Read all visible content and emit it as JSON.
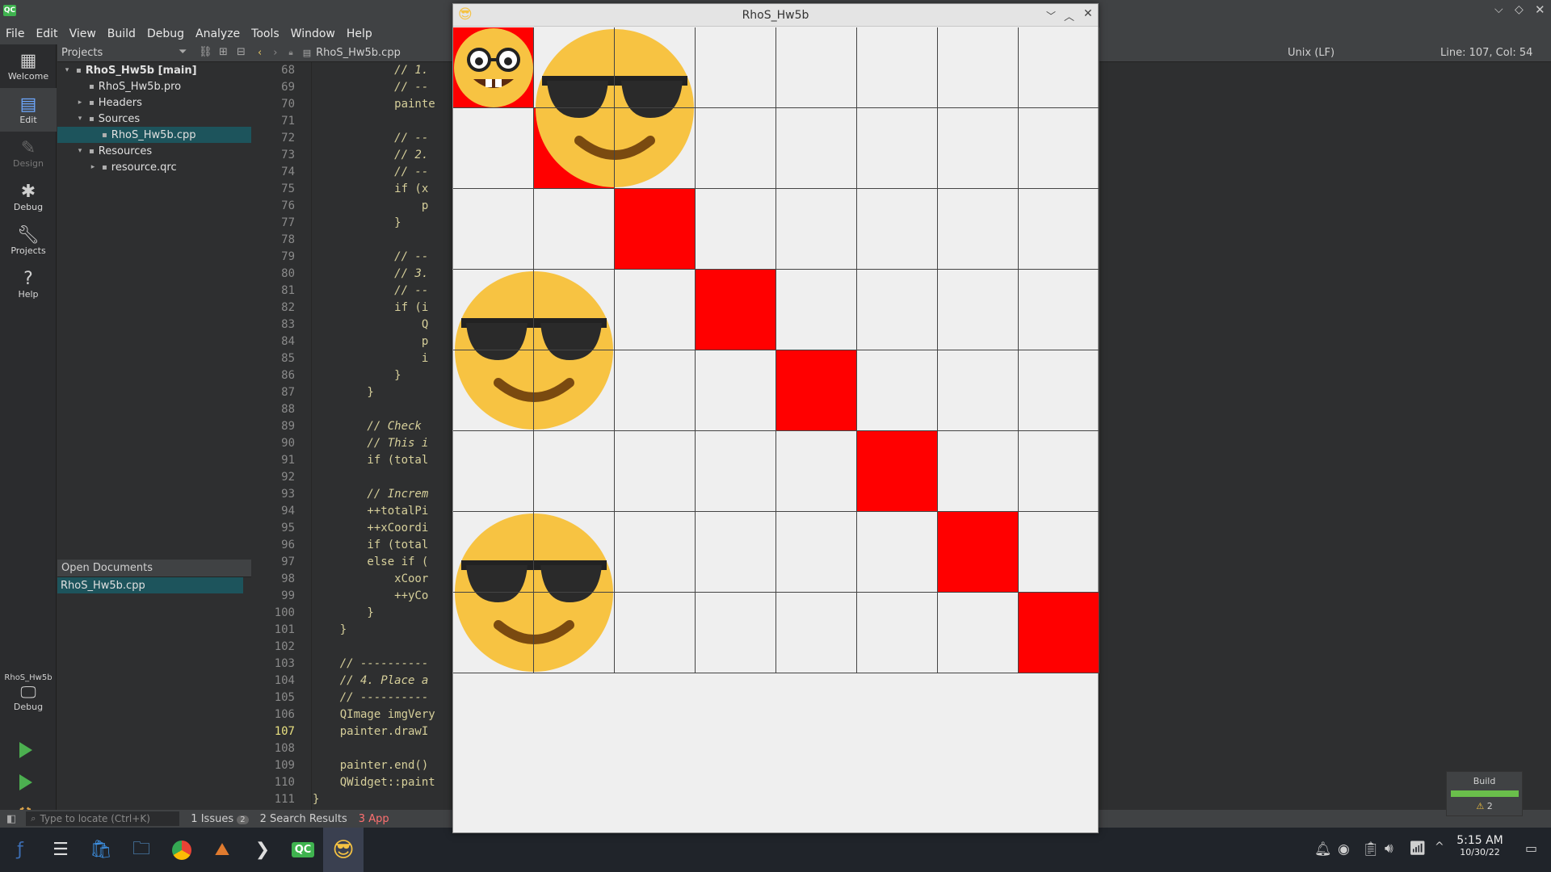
{
  "menu": [
    "File",
    "Edit",
    "View",
    "Build",
    "Debug",
    "Analyze",
    "Tools",
    "Window",
    "Help"
  ],
  "modes": [
    {
      "label": "Welcome",
      "icon": "grid-icon",
      "active": false
    },
    {
      "label": "Edit",
      "icon": "edit-icon",
      "active": true
    },
    {
      "label": "Design",
      "icon": "pen-icon",
      "active": false
    },
    {
      "label": "Debug",
      "icon": "bug-icon",
      "active": false
    },
    {
      "label": "Projects",
      "icon": "wrench-icon",
      "active": false
    },
    {
      "label": "Help",
      "icon": "help-icon",
      "active": false
    }
  ],
  "kit": {
    "project": "RhoS_Hw5b",
    "mode": "Debug"
  },
  "projects": {
    "title": "Projects",
    "tree": [
      {
        "label": "RhoS_Hw5b [main]",
        "indent": 0,
        "bold": true,
        "exp": "▾"
      },
      {
        "label": "RhoS_Hw5b.pro",
        "indent": 1,
        "exp": ""
      },
      {
        "label": "Headers",
        "indent": 1,
        "exp": "▸"
      },
      {
        "label": "Sources",
        "indent": 1,
        "exp": "▾"
      },
      {
        "label": "RhoS_Hw5b.cpp",
        "indent": 2,
        "exp": "",
        "sel": true
      },
      {
        "label": "Resources",
        "indent": 1,
        "exp": "▾"
      },
      {
        "label": "resource.qrc",
        "indent": 2,
        "exp": "▸"
      }
    ]
  },
  "open_documents": {
    "title": "Open Documents",
    "items": [
      "RhoS_Hw5b.cpp"
    ]
  },
  "editor": {
    "file": "RhoS_Hw5b.cpp",
    "encoding": "Unix (LF)",
    "cursor": "Line: 107, Col: 54",
    "current_line": 107,
    "lines": [
      {
        "n": "68",
        "t": "            // 1."
      },
      {
        "n": "69",
        "t": "            // --"
      },
      {
        "n": "70",
        "t": "            painte"
      },
      {
        "n": "71",
        "t": ""
      },
      {
        "n": "72",
        "t": "            // --"
      },
      {
        "n": "73",
        "t": "            // 2."
      },
      {
        "n": "74",
        "t": "            // --"
      },
      {
        "n": "75",
        "t": "            if (x"
      },
      {
        "n": "76",
        "t": "                p"
      },
      {
        "n": "77",
        "t": "            }"
      },
      {
        "n": "78",
        "t": ""
      },
      {
        "n": "79",
        "t": "            // --"
      },
      {
        "n": "80",
        "t": "            // 3."
      },
      {
        "n": "81",
        "t": "            // --"
      },
      {
        "n": "82",
        "t": "            if (i"
      },
      {
        "n": "83",
        "t": "                Q"
      },
      {
        "n": "84",
        "t": "                p"
      },
      {
        "n": "85",
        "t": "                i"
      },
      {
        "n": "86",
        "t": "            }"
      },
      {
        "n": "87",
        "t": "        }"
      },
      {
        "n": "88",
        "t": ""
      },
      {
        "n": "89",
        "t": "        // Check"
      },
      {
        "n": "90",
        "t": "        // This i"
      },
      {
        "n": "91",
        "t": "        if (total"
      },
      {
        "n": "92",
        "t": ""
      },
      {
        "n": "93",
        "t": "        // Increm"
      },
      {
        "n": "94",
        "t": "        ++totalPi"
      },
      {
        "n": "95",
        "t": "        ++xCoordi"
      },
      {
        "n": "96",
        "t": "        if (total"
      },
      {
        "n": "97",
        "t": "        else if ("
      },
      {
        "n": "98",
        "t": "            xCoor"
      },
      {
        "n": "99",
        "t": "            ++yCo"
      },
      {
        "n": "100",
        "t": "        }"
      },
      {
        "n": "101",
        "t": "    }"
      },
      {
        "n": "102",
        "t": ""
      },
      {
        "n": "103",
        "t": "    // ----------"
      },
      {
        "n": "104",
        "t": "    // 4. Place a"
      },
      {
        "n": "105",
        "t": "    // ----------"
      },
      {
        "n": "106",
        "t": "    QImage imgVery"
      },
      {
        "n": "107",
        "t": "    painter.drawI"
      },
      {
        "n": "108",
        "t": ""
      },
      {
        "n": "109",
        "t": "    painter.end()"
      },
      {
        "n": "110",
        "t": "    QWidget::paint"
      },
      {
        "n": "111",
        "t": "}"
      }
    ]
  },
  "output_tabs": [
    {
      "num": "1",
      "label": "Issues",
      "badge": "2"
    },
    {
      "num": "2",
      "label": "Search Results"
    },
    {
      "num": "3",
      "label": "App"
    }
  ],
  "locator": {
    "placeholder": "Type to locate (Ctrl+K)"
  },
  "build": {
    "label": "Build",
    "warnings": "2"
  },
  "app_window": {
    "title": "RhoS_Hw5b",
    "grid_cols": 8,
    "grid_rows": 8,
    "red_cells": [
      [
        0,
        0
      ],
      [
        1,
        1
      ],
      [
        2,
        2
      ],
      [
        3,
        3
      ],
      [
        4,
        4
      ],
      [
        5,
        5
      ],
      [
        6,
        6
      ],
      [
        7,
        7
      ]
    ],
    "big_emojis": [
      [
        1,
        0
      ],
      [
        0,
        3
      ],
      [
        0,
        6
      ]
    ],
    "small_emoji": [
      0,
      0
    ],
    "red_color": "#ff0000"
  },
  "clock": {
    "time": "5:15 AM",
    "date": "10/30/22"
  }
}
